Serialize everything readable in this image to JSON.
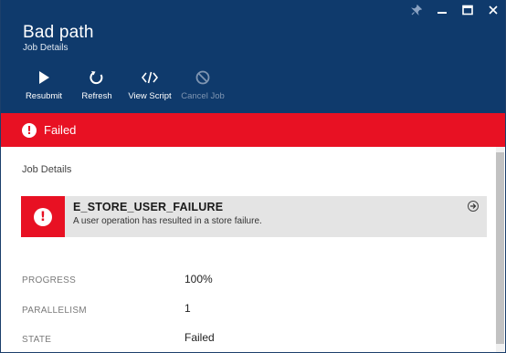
{
  "header": {
    "title": "Bad path",
    "subtitle": "Job Details",
    "bg_color": "#0f3a6c",
    "window_controls": [
      "pin-icon",
      "minimize-icon",
      "maximize-icon",
      "close-icon"
    ]
  },
  "toolbar": {
    "resubmit_label": "Resubmit",
    "refresh_label": "Refresh",
    "view_script_label": "View Script",
    "cancel_job_label": "Cancel Job"
  },
  "status": {
    "text": "Failed",
    "color": "#e81123",
    "icon": "exclamation-icon"
  },
  "content": {
    "section_label": "Job Details",
    "error": {
      "code": "E_STORE_USER_FAILURE",
      "message": "A user operation has resulted in a store failure."
    },
    "properties": [
      {
        "label": "PROGRESS",
        "value": "100%"
      },
      {
        "label": "PARALLELISM",
        "value": "1"
      },
      {
        "label": "STATE",
        "value": "Failed"
      }
    ]
  }
}
